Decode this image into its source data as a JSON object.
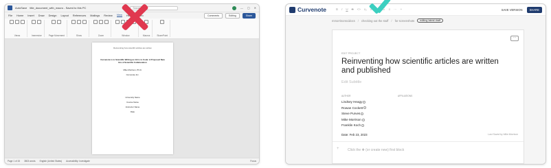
{
  "left": {
    "title_bar": {
      "app": "AutoSave",
      "doc": "title_document_with_macro - Saved to this PC",
      "search": "Search"
    },
    "tabs": [
      "File",
      "Home",
      "Insert",
      "Draw",
      "Design",
      "Layout",
      "References",
      "Mailings",
      "Review",
      "View",
      "Help",
      "Zotero"
    ],
    "active_tab": "View",
    "comments_label": "Comments",
    "editing_label": "Editing",
    "share_label": "Share",
    "ribbon_groups": [
      "Views",
      "Immersive",
      "Page Movement",
      "Show",
      "Zoom",
      "Window",
      "Macros",
      "SharePoint"
    ],
    "page": {
      "header": "Reinventing how scientific articles are written",
      "title": "Curvenote is to Scientific Writing as Git is to Code: A Proposed New Era of Scientific Collaboration",
      "author": "Mike Morrison, Ph.D.",
      "affiliation": "Curvenote Inc.",
      "institution": "University Name",
      "course": "Course Name",
      "instructor": "Instructor Name",
      "date": "Date"
    },
    "status": {
      "page": "Page 1 of 15",
      "words": "3803 words",
      "language": "English (United States)",
      "accessibility": "Accessibility: Investigate",
      "right": "Focus"
    }
  },
  "right": {
    "logo_text": "Curvenote",
    "save_version": "SAVE VERSION",
    "share": "SHARE",
    "breadcrumb": [
      "mmorrisonscidocs",
      "checking out the stuff",
      "for screenshots"
    ],
    "tag": "editing latest draft",
    "edit_project": "EDIT PROJECT",
    "title": "Reinventing how scientific articles are written and published",
    "subtitle": "Edit Subtitle",
    "author_header": "AUTHOR",
    "affiliation_header": "AFFILIATIONS",
    "authors": [
      "Lindsey Heagy",
      "Rowan Cockett",
      "Steve Purves",
      "Mike Morrison",
      "Franklin Koch"
    ],
    "date": "Date: Feb 23, 2023",
    "last_saved": "Last Saved by Mike Morrison",
    "hint": "Click the ✚ (or create new) first block"
  }
}
